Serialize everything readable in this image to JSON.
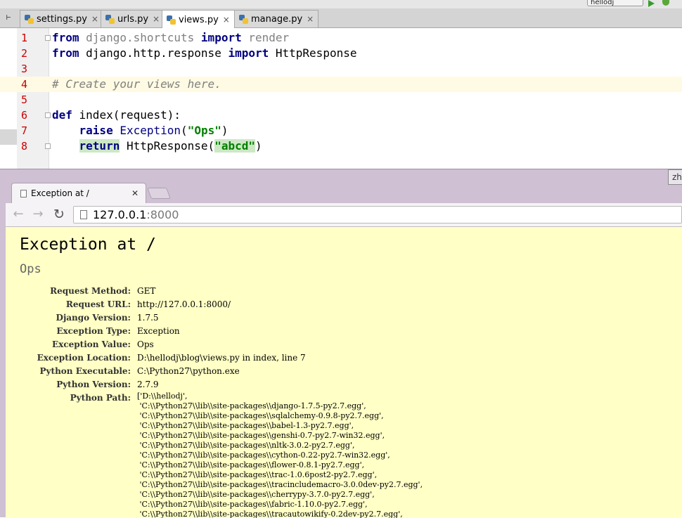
{
  "ide": {
    "run_config": "hellodj",
    "tabs": [
      {
        "label": "settings.py",
        "active": false
      },
      {
        "label": "urls.py",
        "active": false
      },
      {
        "label": "views.py",
        "active": true
      },
      {
        "label": "manage.py",
        "active": false
      }
    ],
    "code_lines": [
      {
        "num": "1",
        "parts": [
          [
            "kw",
            "from"
          ],
          [
            "imp",
            " django.shortcuts "
          ],
          [
            "kw",
            "import"
          ],
          [
            "imp",
            " render"
          ]
        ]
      },
      {
        "num": "2",
        "parts": [
          [
            "kw",
            "from"
          ],
          [
            "",
            " django.http.response "
          ],
          [
            "kw",
            "import"
          ],
          [
            "",
            " HttpResponse"
          ]
        ]
      },
      {
        "num": "3",
        "parts": []
      },
      {
        "num": "4",
        "parts": [
          [
            "cm",
            "# Create your views here."
          ]
        ],
        "highlight": true
      },
      {
        "num": "5",
        "parts": []
      },
      {
        "num": "6",
        "parts": [
          [
            "kw",
            "def"
          ],
          [
            "",
            " index(request):"
          ]
        ]
      },
      {
        "num": "7",
        "parts": [
          [
            "",
            "    "
          ],
          [
            "kw",
            "raise"
          ],
          [
            "",
            " "
          ],
          [
            "blt",
            "Exception"
          ],
          [
            "",
            "("
          ],
          [
            "str",
            "\"Ops\""
          ],
          [
            "",
            ")"
          ]
        ]
      },
      {
        "num": "8",
        "parts": [
          [
            "",
            "    "
          ],
          [
            "kw strhl",
            "return"
          ],
          [
            "",
            " HttpResponse("
          ],
          [
            "str strhl",
            "\"abcd\""
          ],
          [
            "",
            ")"
          ]
        ]
      }
    ]
  },
  "browser": {
    "ime_label": "zh",
    "tab_title": "Exception at /",
    "url_host": "127.0.0.1",
    "url_port": ":8000"
  },
  "error_page": {
    "title": "Exception at /",
    "value": "Ops",
    "meta": [
      {
        "label": "Request Method:",
        "value": "GET"
      },
      {
        "label": "Request URL:",
        "value": "http://127.0.0.1:8000/"
      },
      {
        "label": "Django Version:",
        "value": "1.7.5"
      },
      {
        "label": "Exception Type:",
        "value": "Exception"
      },
      {
        "label": "Exception Value:",
        "value": "Ops"
      },
      {
        "label": "Exception Location:",
        "value": "D:\\hellodj\\blog\\views.py in index, line 7"
      },
      {
        "label": "Python Executable:",
        "value": "C:\\Python27\\python.exe"
      },
      {
        "label": "Python Version:",
        "value": "2.7.9"
      }
    ],
    "python_path_label": "Python Path:",
    "python_path": [
      "['D:\\\\hellodj',",
      " 'C:\\\\Python27\\\\lib\\\\site-packages\\\\django-1.7.5-py2.7.egg',",
      " 'C:\\\\Python27\\\\lib\\\\site-packages\\\\sqlalchemy-0.9.8-py2.7.egg',",
      " 'C:\\\\Python27\\\\lib\\\\site-packages\\\\babel-1.3-py2.7.egg',",
      " 'C:\\\\Python27\\\\lib\\\\site-packages\\\\genshi-0.7-py2.7-win32.egg',",
      " 'C:\\\\Python27\\\\lib\\\\site-packages\\\\nltk-3.0.2-py2.7.egg',",
      " 'C:\\\\Python27\\\\lib\\\\site-packages\\\\cython-0.22-py2.7-win32.egg',",
      " 'C:\\\\Python27\\\\lib\\\\site-packages\\\\flower-0.8.1-py2.7.egg',",
      " 'C:\\\\Python27\\\\lib\\\\site-packages\\\\trac-1.0.6post2-py2.7.egg',",
      " 'C:\\\\Python27\\\\lib\\\\site-packages\\\\tracincludemacro-3.0.0dev-py2.7.egg',",
      " 'C:\\\\Python27\\\\lib\\\\site-packages\\\\cherrypy-3.7.0-py2.7.egg',",
      " 'C:\\\\Python27\\\\lib\\\\site-packages\\\\fabric-1.10.0-py2.7.egg',",
      " 'C:\\\\Python27\\\\lib\\\\site-packages\\\\tracautowikify-0.2dev-py2.7.egg',"
    ]
  }
}
